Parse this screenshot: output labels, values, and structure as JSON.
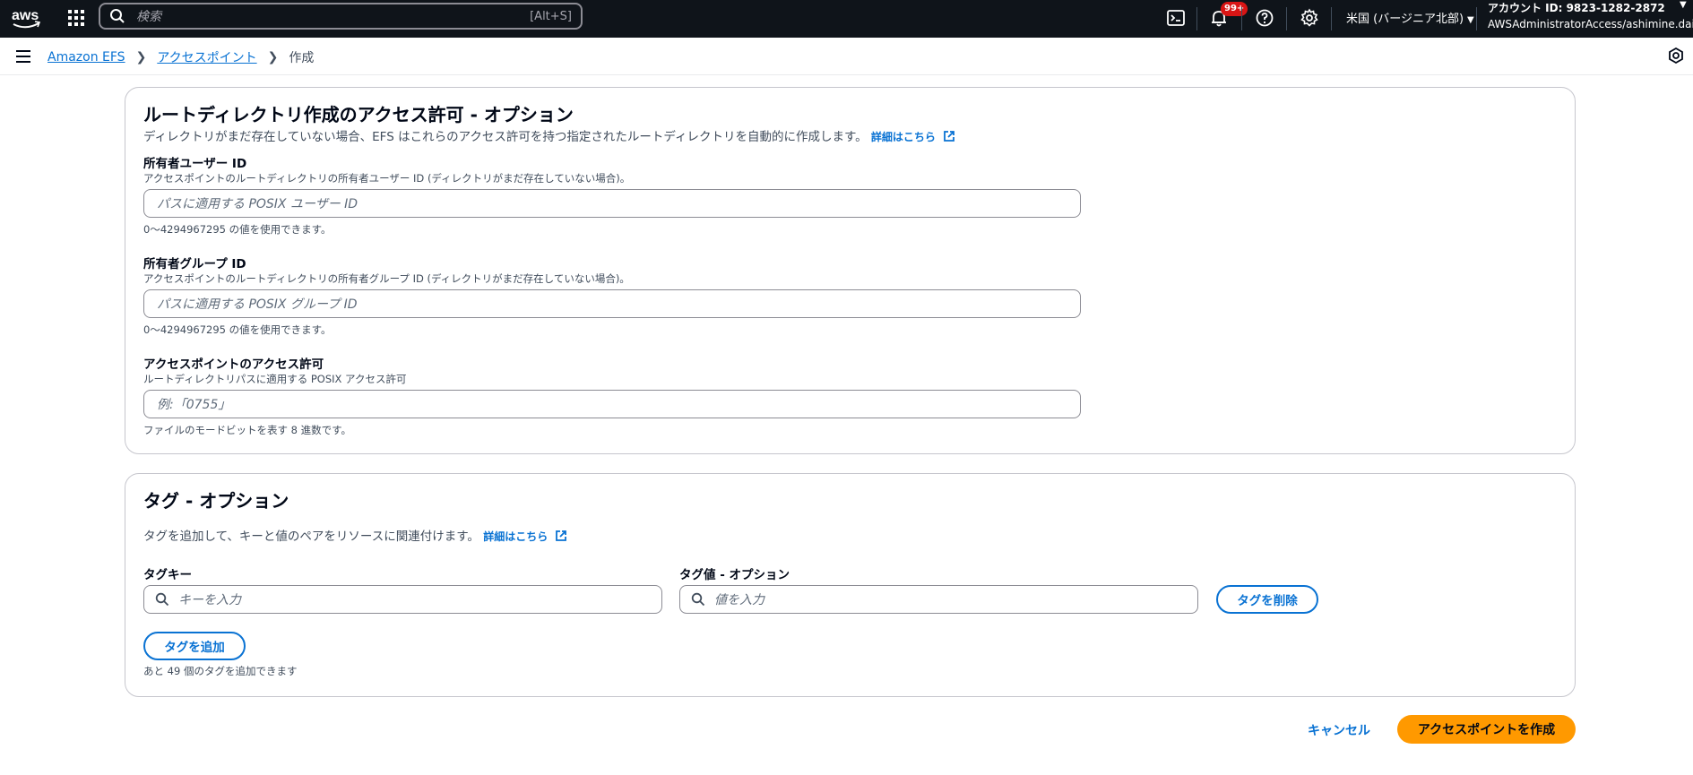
{
  "topnav": {
    "logo_text": "aws",
    "search_placeholder": "検索",
    "search_shortcut": "[Alt+S]",
    "notification_count": "99+",
    "region": "米国 (バージニア北部)",
    "account_id": "アカウント ID: 9823-1282-2872",
    "account_role": "AWSAdministratorAccess/ashimine.daichi",
    "icons": [
      "cloudshell-icon",
      "bell-icon",
      "help-icon",
      "gear-icon"
    ]
  },
  "breadcrumb": {
    "items": [
      "Amazon EFS",
      "アクセスポイント"
    ],
    "current": "作成"
  },
  "root_dir_panel": {
    "title": "ルートディレクトリ作成のアクセス許可 - オプション",
    "description": "ディレクトリがまだ存在していない場合、EFS はこれらのアクセス許可を持つ指定されたルートディレクトリを自動的に作成します。",
    "learn_more": "詳細はこちら",
    "owner_uid": {
      "label": "所有者ユーザー ID",
      "sublabel": "アクセスポイントのルートディレクトリの所有者ユーザー ID (ディレクトリがまだ存在していない場合)。",
      "placeholder": "パスに適用する POSIX ユーザー ID",
      "hint": "0〜4294967295 の値を使用できます。"
    },
    "owner_gid": {
      "label": "所有者グループ ID",
      "sublabel": "アクセスポイントのルートディレクトリの所有者グループ ID (ディレクトリがまだ存在していない場合)。",
      "placeholder": "パスに適用する POSIX グループ ID",
      "hint": "0〜4294967295 の値を使用できます。"
    },
    "permissions": {
      "label": "アクセスポイントのアクセス許可",
      "sublabel": "ルートディレクトリパスに適用する POSIX アクセス許可",
      "placeholder": "例:「0755」",
      "hint": "ファイルのモードビットを表す 8 進数です。"
    }
  },
  "tags_panel": {
    "title": "タグ - オプション",
    "description": "タグを追加して、キーと値のペアをリソースに関連付けます。",
    "learn_more": "詳細はこちら",
    "key_label": "タグキー",
    "key_placeholder": "キーを入力",
    "value_label": "タグ値 - オプション",
    "value_placeholder": "値を入力",
    "remove_button": "タグを削除",
    "add_button": "タグを追加",
    "remaining_hint": "あと 49 個のタグを追加できます"
  },
  "footer": {
    "cancel": "キャンセル",
    "create": "アクセスポイントを作成"
  },
  "colors": {
    "nav_bg": "#0f141a",
    "link": "#0972d3",
    "primary": "#ff9900",
    "badge": "#d91515"
  }
}
